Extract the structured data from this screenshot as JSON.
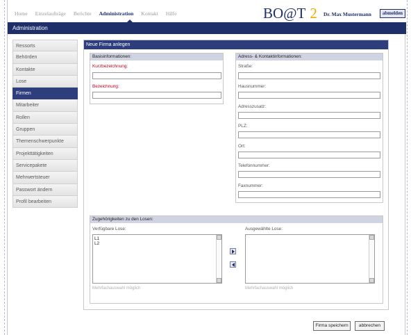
{
  "nav": {
    "items": [
      {
        "label": "Home",
        "active": false
      },
      {
        "label": "Einzelaufträge",
        "active": false
      },
      {
        "label": "Berichte",
        "active": false
      },
      {
        "label": "Administration",
        "active": true
      },
      {
        "label": "Kontakt",
        "active": false
      },
      {
        "label": "Hilfe",
        "active": false
      }
    ]
  },
  "logo": {
    "text": "BO@T",
    "number": "2"
  },
  "user": {
    "name": "Dr. Max Mustermann",
    "logout_label": "abmelden"
  },
  "section_title": "Administration",
  "sidebar": {
    "items": [
      {
        "label": "Ressorts",
        "active": false
      },
      {
        "label": "Behörden",
        "active": false
      },
      {
        "label": "Kontakte",
        "active": false
      },
      {
        "label": "Lose",
        "active": false
      },
      {
        "label": "Firmen",
        "active": true
      },
      {
        "label": "Mitarbeiter",
        "active": false
      },
      {
        "label": "Rollen",
        "active": false
      },
      {
        "label": "Gruppen",
        "active": false
      },
      {
        "label": "Themenschwerpunkte",
        "active": false
      },
      {
        "label": "Projekttätigkeiten",
        "active": false
      },
      {
        "label": "Servicepakete",
        "active": false
      },
      {
        "label": "Mehrwertsteuer",
        "active": false
      },
      {
        "label": "Passwort ändern",
        "active": false
      },
      {
        "label": "Profil bearbeiten",
        "active": false
      }
    ]
  },
  "form": {
    "title": "Neue Firma anlegen",
    "basis": {
      "header": "Basisinformationen:",
      "kurz_label": "Kurzbezeichnung:",
      "kurz_value": "",
      "bez_label": "Bezeichnung:",
      "bez_value": ""
    },
    "adresse": {
      "header": "Adress- & Kontaktinformationen:",
      "fields": [
        {
          "label": "Straße:",
          "value": ""
        },
        {
          "label": "Hausnummer:",
          "value": ""
        },
        {
          "label": "Adresszusatz:",
          "value": ""
        },
        {
          "label": "PLZ:",
          "value": ""
        },
        {
          "label": "Ort:",
          "value": ""
        },
        {
          "label": "Telefonnummer:",
          "value": ""
        },
        {
          "label": "Faxnummer:",
          "value": ""
        }
      ]
    },
    "lose": {
      "header": "Zugehörigkeiten zu den Losen:",
      "available_label": "Verfügbare Lose:",
      "available_items": [
        "L1",
        "L2"
      ],
      "selected_label": "Ausgewählte Lose:",
      "selected_items": [],
      "hint_left": "Mehrfachauswahl möglich",
      "hint_right": "Mehrfachauswahl möglich"
    }
  },
  "actions": {
    "save_label": "Firma speichern",
    "cancel_label": "abbrechen"
  },
  "colors": {
    "brand": "#1f2f6a",
    "accent": "#f2a900",
    "required": "#c0001b"
  }
}
